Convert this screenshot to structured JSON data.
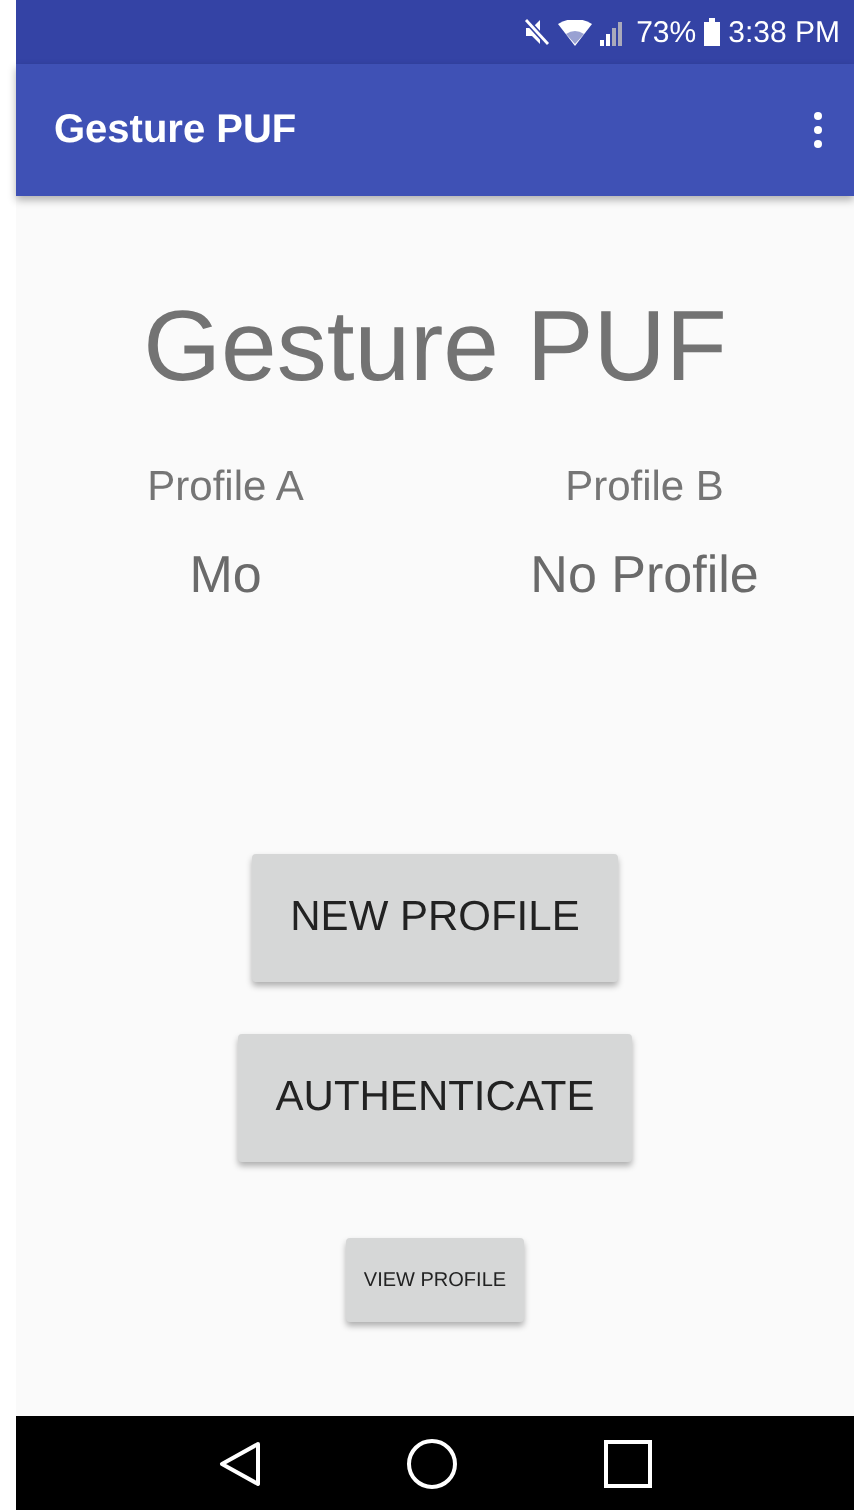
{
  "status_bar": {
    "battery": "73%",
    "time": "3:38 PM"
  },
  "app_bar": {
    "title": "Gesture PUF"
  },
  "heading": "Gesture PUF",
  "profiles": [
    {
      "label": "Profile A",
      "value": "Mo"
    },
    {
      "label": "Profile B",
      "value": "No Profile"
    }
  ],
  "buttons": [
    {
      "label": "NEW PROFILE",
      "kind": "large"
    },
    {
      "label": "AUTHENTICATE",
      "kind": "large"
    },
    {
      "label": "VIEW PROFILE",
      "kind": "small"
    }
  ]
}
